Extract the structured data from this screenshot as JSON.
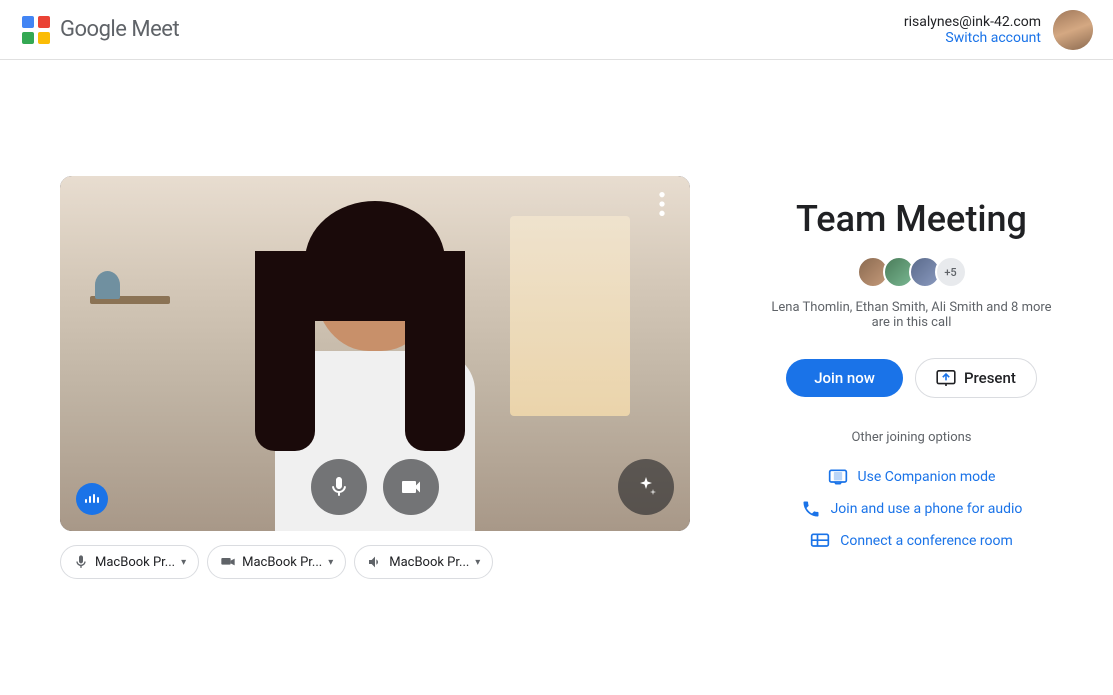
{
  "header": {
    "logo_text": "Google Meet",
    "account_email": "risalynes@ink-42.com",
    "switch_account_label": "Switch account"
  },
  "video_preview": {
    "more_options_label": "⋮"
  },
  "device_selectors": [
    {
      "icon": "mic",
      "label": "MacBook Pr...",
      "id": "microphone"
    },
    {
      "icon": "camera",
      "label": "MacBook Pr...",
      "id": "camera"
    },
    {
      "icon": "speaker",
      "label": "MacBook Pr...",
      "id": "speaker"
    }
  ],
  "meeting": {
    "title": "Team Meeting",
    "participants_text": "Lena Thomlin, Ethan Smith, Ali Smith and 8 more are in this call",
    "participants_more_label": "+5",
    "join_now_label": "Join now",
    "present_label": "Present",
    "other_options_title": "Other joining options",
    "other_options": [
      {
        "id": "companion",
        "label": "Use Companion mode"
      },
      {
        "id": "phone",
        "label": "Join and use a phone for audio"
      },
      {
        "id": "conference",
        "label": "Connect a conference room"
      }
    ]
  }
}
